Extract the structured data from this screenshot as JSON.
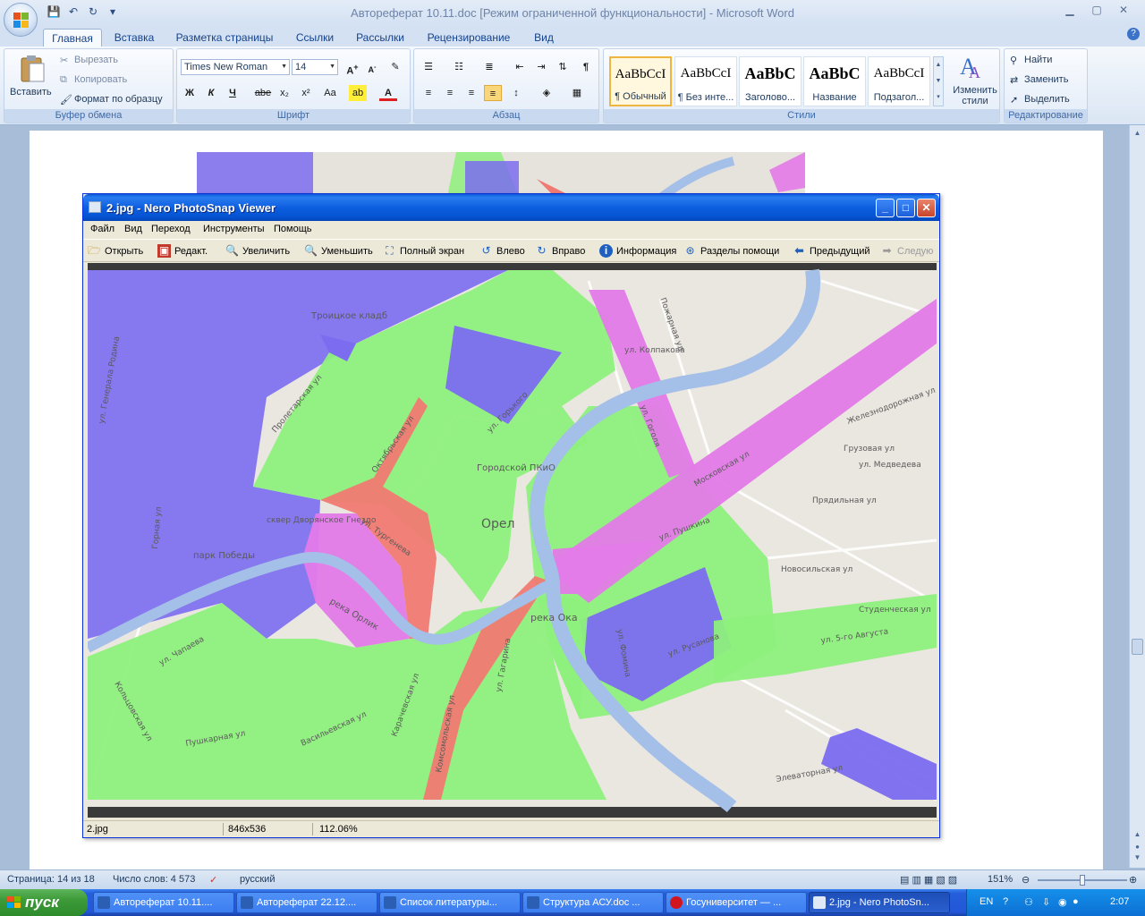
{
  "word": {
    "window_title": "Автореферат 10.11.doc [Режим ограниченной функциональности] - Microsoft Word",
    "tabs": [
      "Главная",
      "Вставка",
      "Разметка страницы",
      "Ссылки",
      "Рассылки",
      "Рецензирование",
      "Вид"
    ],
    "active_tab": "Главная",
    "clipboard": {
      "paste": "Вставить",
      "cut": "Вырезать",
      "copy": "Копировать",
      "format_painter": "Формат по образцу",
      "label": "Буфер обмена"
    },
    "font": {
      "name": "Times New Roman",
      "size": "14",
      "label": "Шрифт",
      "bold": "Ж",
      "italic": "К",
      "underline": "Ч",
      "strike": "abe",
      "subscript": "x₂",
      "superscript": "x²",
      "case": "Aa"
    },
    "paragraph": {
      "label": "Абзац"
    },
    "styles": {
      "label": "Стили",
      "items": [
        {
          "sample": "AaBbCcI",
          "name": "¶ Обычный"
        },
        {
          "sample": "AaBbCcI",
          "name": "¶ Без инте..."
        },
        {
          "sample": "AaBbC",
          "name": "Заголово..."
        },
        {
          "sample": "AaBbC",
          "name": "Название"
        },
        {
          "sample": "AaBbCcI",
          "name": "Подзагол..."
        }
      ],
      "change_styles": "Изменить стили"
    },
    "editing": {
      "label": "Редактирование",
      "find": "Найти",
      "replace": "Заменить",
      "select": "Выделить"
    },
    "status": {
      "page": "Страница: 14 из 18",
      "words": "Число слов: 4 573",
      "language": "русский",
      "zoom": "151%"
    },
    "zoom_fraction": 0.5
  },
  "viewer": {
    "title": "2.jpg - Nero PhotoSnap Viewer",
    "menu": [
      "Файл",
      "Вид",
      "Переход",
      "Инструменты",
      "Помощь"
    ],
    "toolbar": [
      {
        "label": "Открыть",
        "icon": "open-icon"
      },
      {
        "label": "Редакт.",
        "icon": "edit-icon"
      },
      {
        "label": "Увеличить",
        "icon": "zoom-in-icon"
      },
      {
        "label": "Уменьшить",
        "icon": "zoom-out-icon"
      },
      {
        "label": "Полный экран",
        "icon": "fullscreen-icon"
      },
      {
        "label": "Влево",
        "icon": "rotate-left-icon"
      },
      {
        "label": "Вправо",
        "icon": "rotate-right-icon"
      },
      {
        "label": "Информация",
        "icon": "info-icon"
      },
      {
        "label": "Разделы помощи",
        "icon": "help-icon"
      },
      {
        "label": "Предыдущий",
        "icon": "prev-icon"
      },
      {
        "label": "Следую",
        "icon": "next-icon"
      }
    ],
    "status": {
      "file": "2.jpg",
      "dimensions": "846x536",
      "zoom": "112.06%"
    },
    "map_labels": {
      "city": "Орел",
      "river_oka": "река Ока",
      "river_orlik": "река Орлик",
      "park_pobedy": "парк Победы",
      "park_pkio": "Городской ПКиО",
      "troitskoe": "Троицкое кладб",
      "dvoryanskoe": "сквер Дворянское Гнездо",
      "streets": [
        "ул. Пушкина",
        "Новосильская ул",
        "Студенческая ул",
        "ул. 5-го Августа",
        "Московская ул",
        "Грузовая ул",
        "ул. Медведева",
        "Прядильная ул",
        "Железнодорожная ул",
        "ул. Гоголя",
        "ул. Колпакова",
        "Пожарная ул",
        "ул. Горького",
        "Октябрьская ул",
        "ул. Тургенева",
        "Пролетарская ул",
        "Комсомольская ул",
        "Карачевская ул",
        "ул. Гагарина",
        "ул. Фомина",
        "ул. Русанова",
        "Кольцовская ул",
        "ул. Генерала Родина",
        "Горная ул",
        "Элеваторная ул",
        "Пушкарная ул",
        "Васильевская ул",
        "ул. Чапаева"
      ]
    },
    "colors": {
      "zone_blue": "#7b6cf0",
      "zone_green": "#8ef07c",
      "zone_red": "#f07a72",
      "zone_magenta": "#e37ae8",
      "river": "#a4bfe8",
      "base_map": "#eae6e0"
    }
  },
  "taskbar": {
    "start": "пуск",
    "items": [
      "Автореферат 10.11....",
      "Автореферат 22.12....",
      "Список литературы...",
      "Структура АСУ.doc ...",
      "Госуниверситет — ...",
      "2.jpg - Nero PhotoSn..."
    ],
    "active_index": 5,
    "lang": "EN",
    "clock": "2:07"
  }
}
